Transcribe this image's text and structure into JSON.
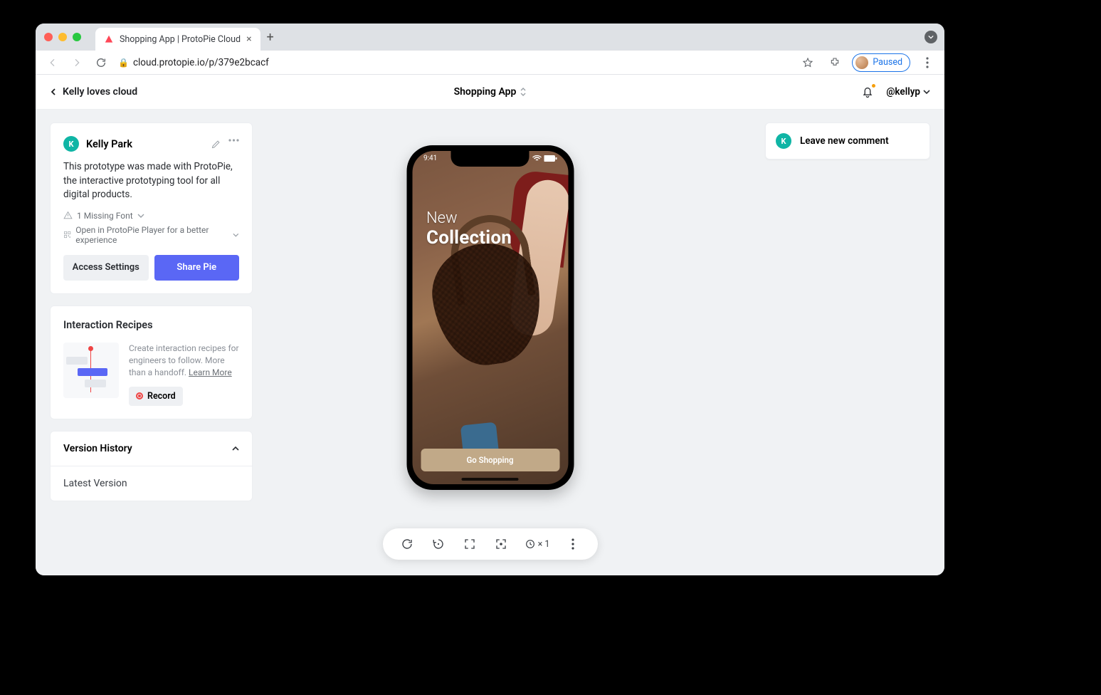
{
  "browser": {
    "tab_title": "Shopping App | ProtoPie Cloud",
    "url": "cloud.protopie.io/p/379e2bcacf",
    "paused_label": "Paused"
  },
  "header": {
    "back_label": "Kelly loves cloud",
    "project_title": "Shopping App",
    "username": "@kellyp"
  },
  "info_card": {
    "owner_initial": "K",
    "owner_name": "Kelly Park",
    "description": "This prototype was made with ProtoPie, the interactive prototyping tool for all digital products.",
    "missing_font": "1 Missing Font",
    "player_hint": "Open in ProtoPie Player for a better experience",
    "access_btn": "Access Settings",
    "share_btn": "Share Pie"
  },
  "recipes": {
    "title": "Interaction Recipes",
    "text": "Create interaction recipes for engineers to follow. More than a handoff. ",
    "learn_more": "Learn More",
    "record_btn": "Record"
  },
  "version_history": {
    "title": "Version History",
    "latest": "Latest Version"
  },
  "comment": {
    "avatar_initial": "K",
    "placeholder": "Leave new comment"
  },
  "phone": {
    "time": "9:41",
    "hero_line1": "New",
    "hero_line2": "Collection",
    "cta": "Go Shopping"
  },
  "toolbar": {
    "speed": "× 1"
  }
}
